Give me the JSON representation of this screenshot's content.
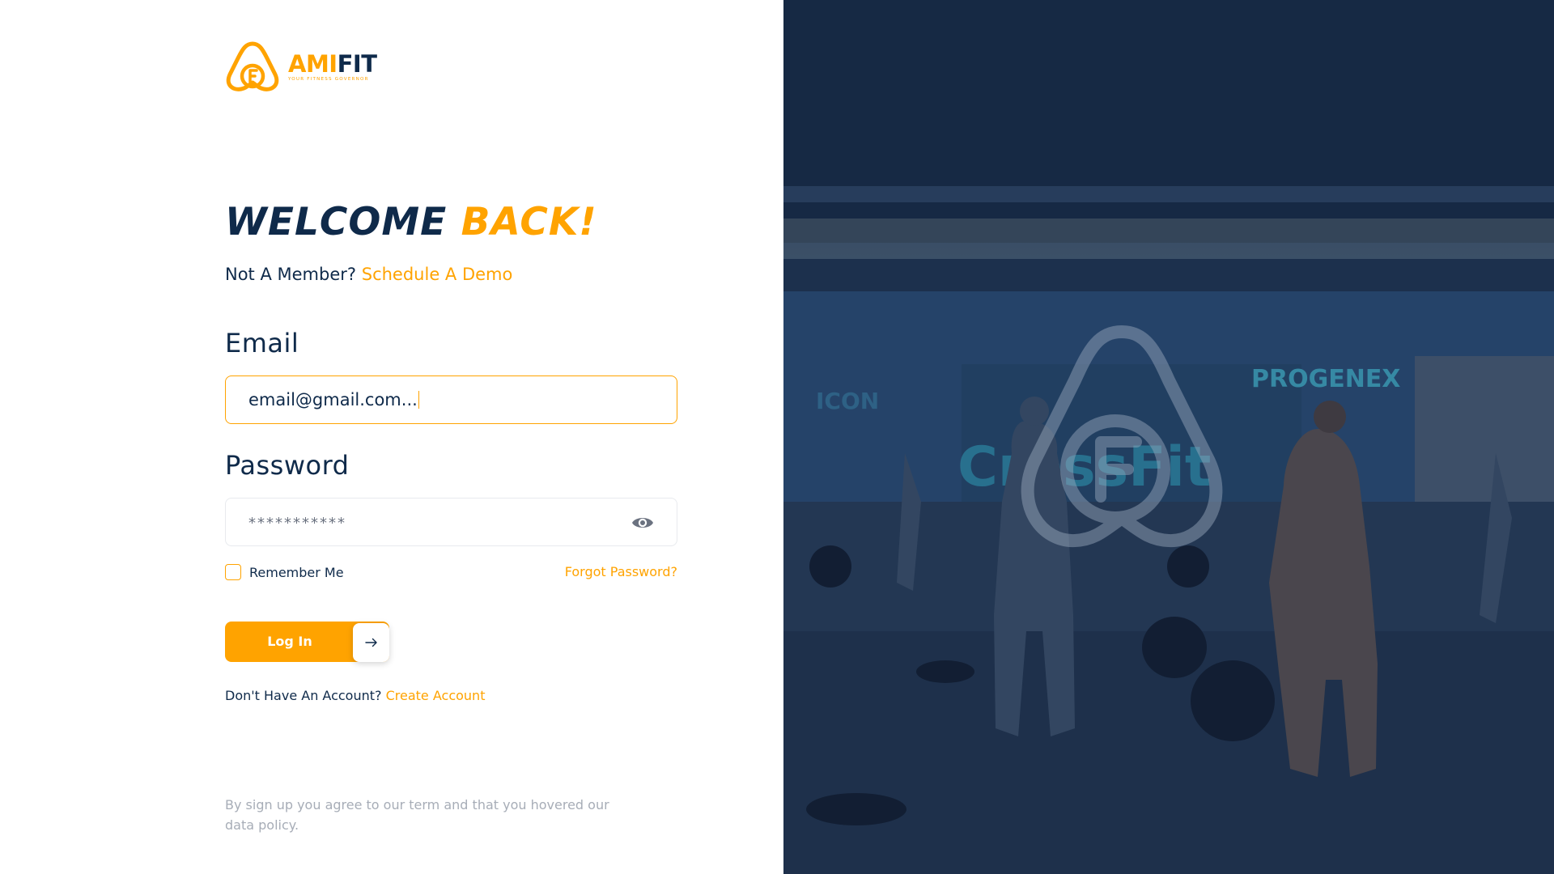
{
  "brand": {
    "name_part1": "AMI",
    "name_part2": "FIT",
    "tagline": "YOUR FITNESS GOVERNOR"
  },
  "heading": {
    "part1": "WELCOME",
    "part2": "BACK!"
  },
  "member_prompt": {
    "text": "Not A Member?",
    "link": "Schedule A Demo"
  },
  "form": {
    "email_label": "Email",
    "email_value": "email@gmail.com...",
    "password_label": "Password",
    "password_value": "***********",
    "remember_label": "Remember Me",
    "forgot_label": "Forgot Password?",
    "login_label": "Log In"
  },
  "signup_prompt": {
    "text": "Don't Have An Account?",
    "link": "Create Account"
  },
  "legal_text": "By sign up you agree to our term and that you hovered our data policy.",
  "hero": {
    "sign_text_1": "PROGENEX",
    "sign_text_2": "CrossFit",
    "sign_text_3": "ICON"
  },
  "colors": {
    "accent": "#FFA300",
    "navy": "#0F2A4A",
    "muted": "#A7ADB7",
    "input_border": "#E8EAEE"
  },
  "icons": {
    "logo": "amifit-logo-icon",
    "password_toggle": "eye-icon",
    "submit_arrow": "arrow-right-icon"
  }
}
